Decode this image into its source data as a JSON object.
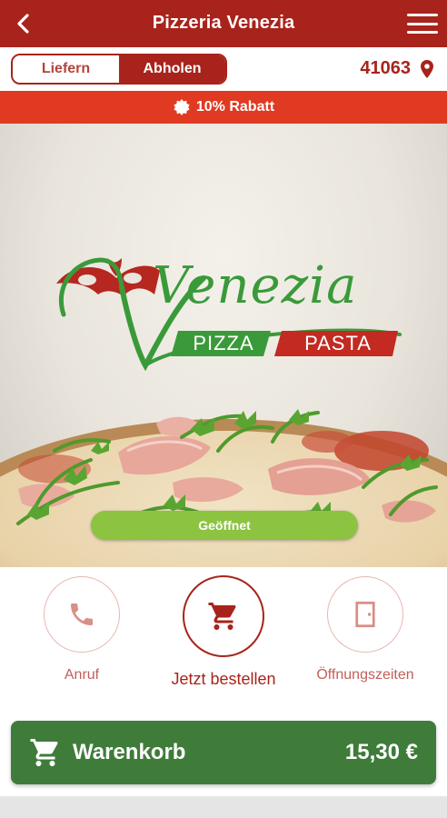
{
  "header": {
    "title": "Pizzeria Venezia",
    "back_icon": "chevron-left-icon",
    "menu_icon": "hamburger-menu-icon"
  },
  "mode_toggle": {
    "options": [
      {
        "label": "Liefern",
        "selected": false
      },
      {
        "label": "Abholen",
        "selected": true
      }
    ]
  },
  "location": {
    "zip": "41063",
    "icon": "map-pin-icon"
  },
  "promo": {
    "text": "10% Rabatt",
    "icon": "badge-icon"
  },
  "hero": {
    "logo": {
      "name": "Venezia",
      "tag_left": "PIZZA",
      "tag_right": "PASTA"
    },
    "status": "Geöffnet"
  },
  "actions": [
    {
      "label": "Anruf",
      "icon": "phone-icon"
    },
    {
      "label": "Jetzt bestellen",
      "icon": "cart-icon"
    },
    {
      "label": "Öffnungszeiten",
      "icon": "door-icon"
    }
  ],
  "cart": {
    "label": "Warenkorb",
    "total": "15,30 €",
    "icon": "cart-icon"
  },
  "colors": {
    "primary": "#a8231b",
    "promo": "#e03a22",
    "open_green": "#8cc341",
    "cart_green": "#3f7c3a"
  }
}
